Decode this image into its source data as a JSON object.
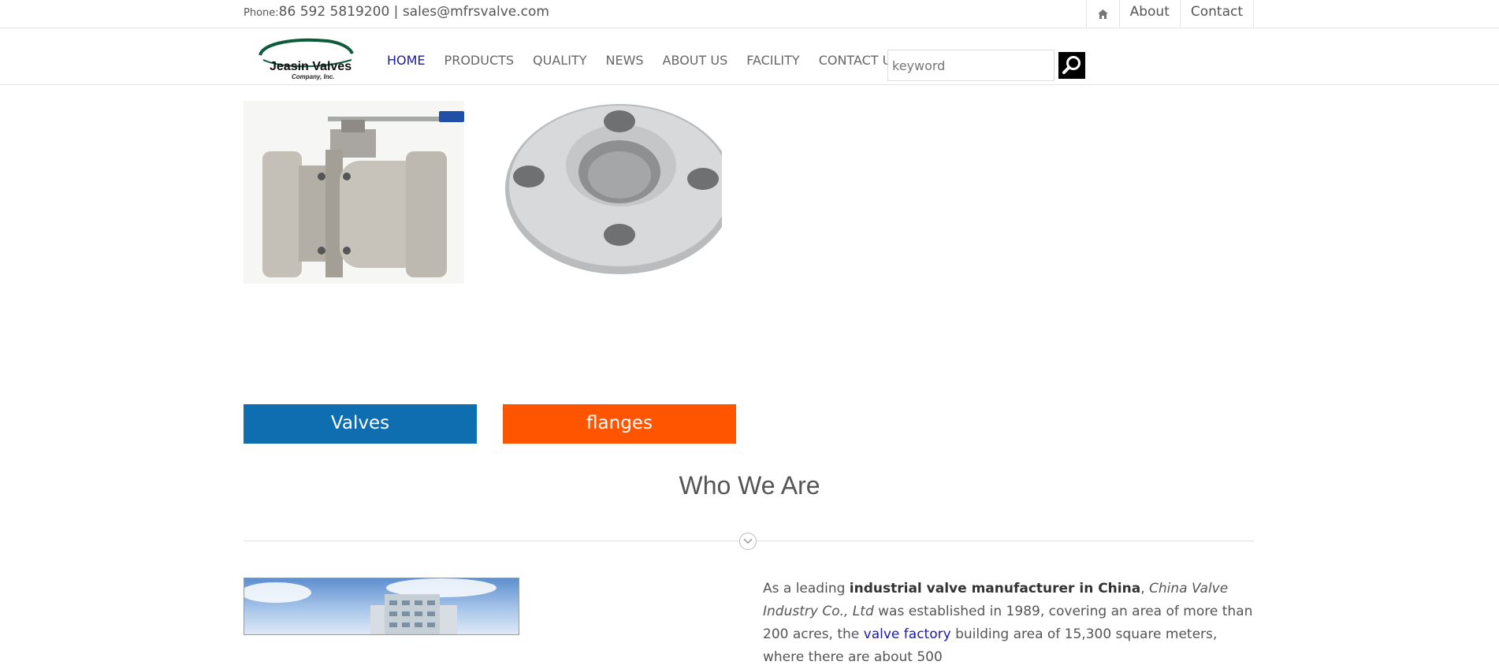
{
  "topbar": {
    "phone_label": "Phone:",
    "phone": "86 592 5819200",
    "separator": "|",
    "email": "sales@mfrsvalve.com",
    "links": [
      "About",
      "Contact"
    ]
  },
  "logo": {
    "text": "Jeasin Valves",
    "subtext": "Company, Inc."
  },
  "nav": {
    "items": [
      "HOME",
      "PRODUCTS",
      "QUALITY",
      "NEWS",
      "ABOUT US",
      "FACILITY",
      "CONTACT US"
    ],
    "active": "HOME"
  },
  "search": {
    "placeholder": "keyword"
  },
  "categories": {
    "valves": "Valves",
    "flanges": "flanges"
  },
  "section": {
    "title": "Who We Are"
  },
  "about": {
    "t1": "As a leading ",
    "b1": "industrial valve manufacturer in China",
    "t2": ", ",
    "i1": "China Valve Industry Co., Ltd",
    "t3": " was established in 1989, covering an area of more than 200 acres, the ",
    "link": "valve factory",
    "t4": " building area of 15,300 square meters, where there are about 500"
  },
  "colors": {
    "valves": "#0e6eaf",
    "flanges": "#ff5500",
    "link": "#1a1aa6"
  },
  "icons": [
    "home-icon",
    "search-icon",
    "chevron-down-icon"
  ]
}
